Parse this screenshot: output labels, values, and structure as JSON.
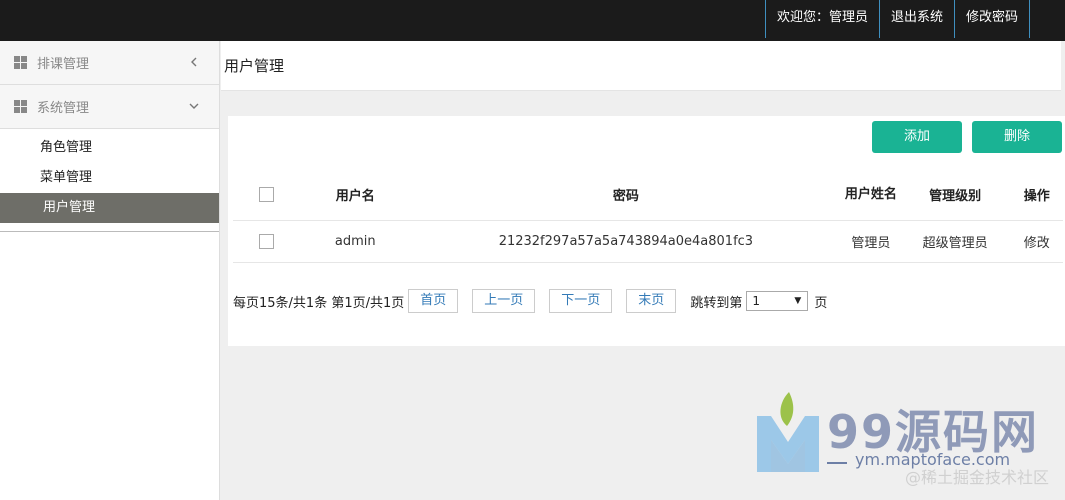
{
  "topbar": {
    "welcome": "欢迎您：管理员",
    "logout": "退出系统",
    "change_password": "修改密码"
  },
  "sidebar": {
    "groups": [
      {
        "label": "排课管理",
        "expanded": false
      },
      {
        "label": "系统管理",
        "expanded": true
      }
    ],
    "sub_items": [
      {
        "label": "角色管理"
      },
      {
        "label": "菜单管理"
      },
      {
        "label": "用户管理",
        "active": true
      }
    ]
  },
  "main": {
    "page_title": "用户管理",
    "add_label": "添加",
    "delete_label": "删除",
    "columns": [
      "用户名",
      "密码",
      "用户姓名",
      "管理级别",
      "操作"
    ],
    "rows": [
      {
        "username": "admin",
        "password": "21232f297a57a5a743894a0e4a801fc3",
        "name": "管理员",
        "level": "超级管理员",
        "op": "修改"
      }
    ],
    "pager": {
      "summary": "每页15条/共1条 第1页/共1页",
      "first": "首页",
      "prev": "上一页",
      "next": "下一页",
      "last": "末页",
      "jump_label": "跳转到第",
      "page_value": "1",
      "page_suffix": "页"
    }
  },
  "watermark": {
    "title": "99源码网",
    "url": "ym.maptoface.com",
    "credit": "@稀土掘金技术社区"
  },
  "colors": {
    "accent": "#1ab394",
    "topbar": "#1b1b1b",
    "active_item": "#6e6e68",
    "link": "#337ab7"
  }
}
